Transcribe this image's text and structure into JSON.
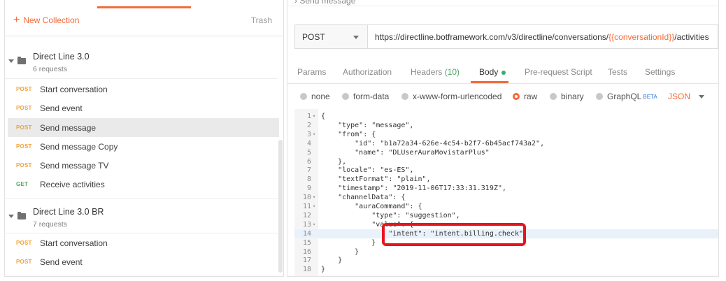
{
  "sidebar": {
    "new_collection_label": "New Collection",
    "trash_label": "Trash",
    "collections": [
      {
        "name": "Direct Line 3.0",
        "count": "6 requests",
        "requests": [
          {
            "method": "POST",
            "name": "Start conversation",
            "active": false
          },
          {
            "method": "POST",
            "name": "Send event",
            "active": false
          },
          {
            "method": "POST",
            "name": "Send message",
            "active": true
          },
          {
            "method": "POST",
            "name": "Send message Copy",
            "active": false
          },
          {
            "method": "POST",
            "name": "Send message TV",
            "active": false
          },
          {
            "method": "GET",
            "name": "Receive activities",
            "active": false
          }
        ]
      },
      {
        "name": "Direct Line 3.0 BR",
        "count": "7 requests",
        "requests": [
          {
            "method": "POST",
            "name": "Start conversation",
            "active": false
          },
          {
            "method": "POST",
            "name": "Send event",
            "active": false
          }
        ]
      }
    ]
  },
  "request": {
    "breadcrumb": "Send message",
    "method": "POST",
    "url_prefix": "https://directline.botframework.com/v3/directline/conversations/",
    "url_variable": "{{conversationId}}",
    "url_suffix": "/activities"
  },
  "tabs": [
    {
      "label": "Params"
    },
    {
      "label": "Authorization"
    },
    {
      "label": "Headers",
      "count": "(10)"
    },
    {
      "label": "Body"
    },
    {
      "label": "Pre-request Script"
    },
    {
      "label": "Tests"
    },
    {
      "label": "Settings"
    }
  ],
  "active_tab": "Body",
  "body_types": [
    {
      "label": "none",
      "selected": false
    },
    {
      "label": "form-data",
      "selected": false
    },
    {
      "label": "x-www-form-urlencoded",
      "selected": false
    },
    {
      "label": "raw",
      "selected": true
    },
    {
      "label": "binary",
      "selected": false
    },
    {
      "label": "GraphQL",
      "selected": false,
      "badge": "BETA"
    }
  ],
  "format": "JSON",
  "code_lines": [
    {
      "n": "1",
      "text": "{"
    },
    {
      "n": "2",
      "text": "    \"type\": \"message\","
    },
    {
      "n": "3",
      "text": "    \"from\": {"
    },
    {
      "n": "4",
      "text": "        \"id\": \"b1a72a34-626e-4c54-b2f7-6b45acf743a2\","
    },
    {
      "n": "5",
      "text": "        \"name\": \"DLUserAuraMovistarPlus\""
    },
    {
      "n": "6",
      "text": "    },"
    },
    {
      "n": "7",
      "text": "    \"locale\": \"es-ES\","
    },
    {
      "n": "8",
      "text": "    \"textFormat\": \"plain\","
    },
    {
      "n": "9",
      "text": "    \"timestamp\": \"2019-11-06T17:33:31.319Z\","
    },
    {
      "n": "10",
      "text": "    \"channelData\": {"
    },
    {
      "n": "11",
      "text": "        \"auraCommand\": {"
    },
    {
      "n": "12",
      "text": "            \"type\": \"suggestion\","
    },
    {
      "n": "13",
      "text": "            \"value\": {"
    },
    {
      "n": "14",
      "text": "                \"intent\": \"intent.billing.check\""
    },
    {
      "n": "15",
      "text": "            }"
    },
    {
      "n": "16",
      "text": "        }"
    },
    {
      "n": "17",
      "text": "    }"
    },
    {
      "n": "18",
      "text": "}"
    }
  ],
  "highlighted_line": "14",
  "colors": {
    "accent": "#f26b3a",
    "post": "#f0a33a",
    "get": "#56a665",
    "callout": "#e8141c"
  }
}
